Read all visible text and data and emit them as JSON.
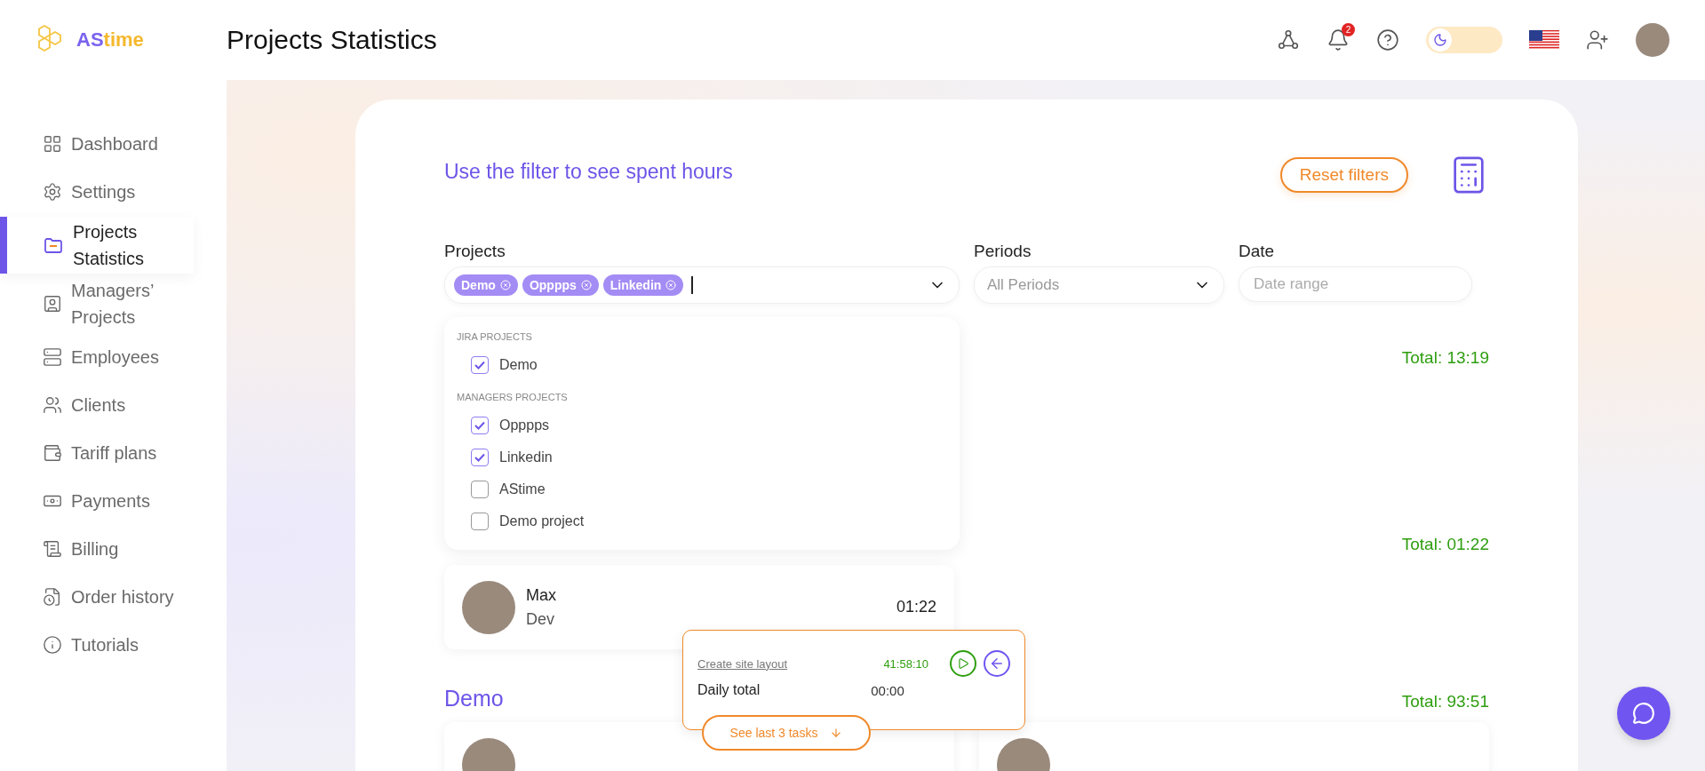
{
  "logo": {
    "part_1": "AS",
    "part_2": "time"
  },
  "header": {
    "title": "Projects Statistics",
    "notification_count": "2",
    "theme_toggle": {
      "on": false
    }
  },
  "sidebar": {
    "items": [
      {
        "label": "Dashboard",
        "kind": "dashboard",
        "selected": false
      },
      {
        "label": "Settings",
        "kind": "settings",
        "selected": false
      },
      {
        "label": "Projects Statistics",
        "kind": "projects",
        "selected": true
      },
      {
        "label": "Managers’ Projects",
        "kind": "managers",
        "selected": false
      },
      {
        "label": "Employees",
        "kind": "employees",
        "selected": false
      },
      {
        "label": "Clients",
        "kind": "clients",
        "selected": false
      },
      {
        "label": "Tariff plans",
        "kind": "tariff",
        "selected": false
      },
      {
        "label": "Payments",
        "kind": "payments",
        "selected": false
      },
      {
        "label": "Billing",
        "kind": "billing",
        "selected": false
      },
      {
        "label": "Order history",
        "kind": "orders",
        "selected": false
      },
      {
        "label": "Tutorials",
        "kind": "tutorials",
        "selected": false
      }
    ]
  },
  "filter": {
    "heading": "Use the filter to see spent hours",
    "reset_button": "Reset filters",
    "projects": {
      "label": "Projects",
      "tags": [
        "Demo",
        "Opppps",
        "Linkedin"
      ]
    },
    "periods": {
      "label": "Periods",
      "value": "All Periods"
    },
    "date": {
      "label": "Date",
      "placeholder": "Date range"
    }
  },
  "dropdown": {
    "groups": [
      {
        "title": "JIRA PROJECTS",
        "options": [
          {
            "label": "Demo",
            "checked": true
          }
        ]
      },
      {
        "title": "MANAGERS PROJECTS",
        "options": [
          {
            "label": "Opppps",
            "checked": true
          },
          {
            "label": "Linkedin",
            "checked": true
          },
          {
            "label": "AStime",
            "checked": false
          },
          {
            "label": "Demo project",
            "checked": false
          }
        ]
      }
    ]
  },
  "sections": [
    {
      "total": "Total: 13:19"
    },
    {
      "total": "Total: 01:22",
      "cards": [
        {
          "kind": "person",
          "name": "Max",
          "role": "Dev",
          "time": "01:22"
        }
      ]
    },
    {
      "title": "Demo",
      "total": "Total: 93:51",
      "cards": [
        {
          "kind": "person"
        },
        {
          "kind": "person"
        }
      ]
    }
  ],
  "timer": {
    "task": "Create site layout",
    "elapsed": "41:58:10",
    "daily_label": "Daily total",
    "daily_value": "00:00",
    "last_tasks_button": "See last 3 tasks"
  }
}
